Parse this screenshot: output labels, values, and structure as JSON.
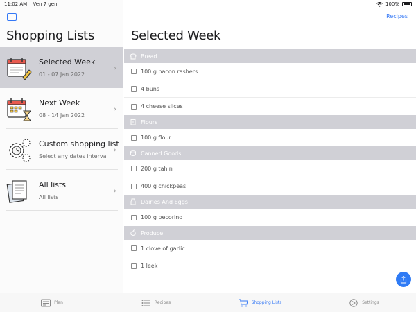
{
  "status": {
    "time": "11:02 AM",
    "date": "Ven 7 gen",
    "battery": "100%"
  },
  "sidebar": {
    "title": "Shopping Lists",
    "items": [
      {
        "label": "Selected Week",
        "sub": "01 - 07 Jan 2022",
        "icon": "calendar-pencil-icon",
        "active": true
      },
      {
        "label": "Next Week",
        "sub": "08 - 14 Jan 2022",
        "icon": "calendar-hourglass-icon",
        "active": false
      },
      {
        "label": "Custom shopping list",
        "sub": "Select any dates interval",
        "icon": "gears-clock-icon",
        "active": false
      },
      {
        "label": "All lists",
        "sub": "All lists",
        "icon": "documents-icon",
        "active": false
      }
    ]
  },
  "detail": {
    "recipes_link": "Recipes",
    "title": "Selected Week",
    "sections": [
      {
        "name": "Bread",
        "icon": "bread-icon",
        "items": [
          "100 g bacon rashers",
          "4 buns",
          "4 cheese slices"
        ]
      },
      {
        "name": "Flours",
        "icon": "flour-icon",
        "items": [
          "100 g flour"
        ]
      },
      {
        "name": "Canned Goods",
        "icon": "can-icon",
        "items": [
          "200 g tahin",
          "400 g chickpeas"
        ]
      },
      {
        "name": "Dairies And Eggs",
        "icon": "milk-icon",
        "items": [
          "100 g pecorino"
        ]
      },
      {
        "name": "Produce",
        "icon": "produce-icon",
        "items": [
          "1 clove of garlic",
          "1 leek"
        ]
      }
    ]
  },
  "tabs": [
    {
      "label": "Plan",
      "icon": "plan-icon",
      "active": false
    },
    {
      "label": "Recipes",
      "icon": "list-icon",
      "active": false
    },
    {
      "label": "Shopping Lists",
      "icon": "cart-icon",
      "active": true
    },
    {
      "label": "Settings",
      "icon": "settings-icon",
      "active": false
    }
  ],
  "colors": {
    "accent": "#3478f6",
    "selected_row": "#d0d0d6",
    "section_header": "#d0d0d6"
  }
}
